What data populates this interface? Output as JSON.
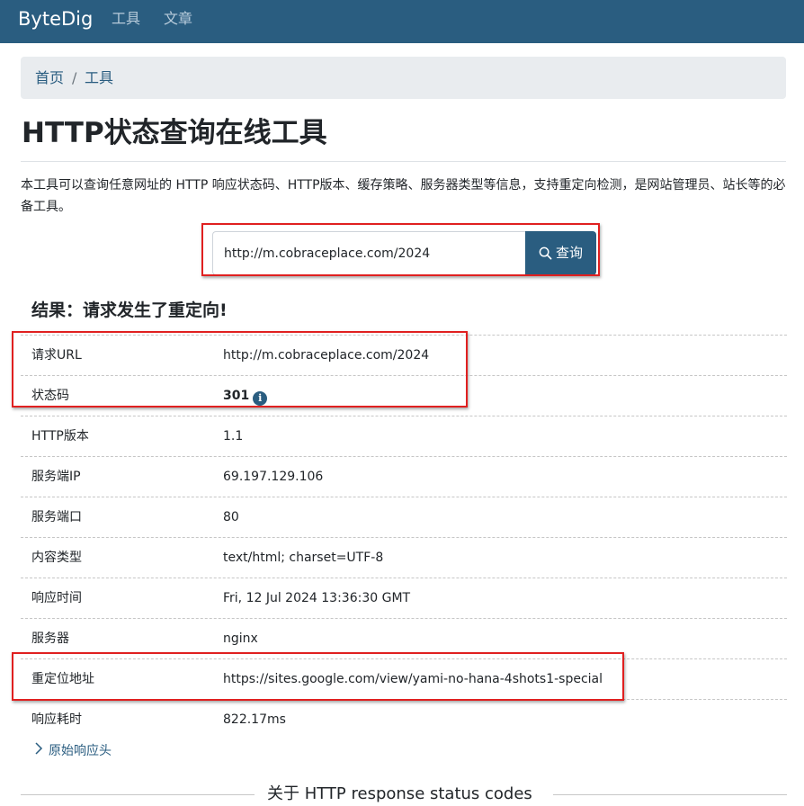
{
  "navbar": {
    "brand": "ByteDig",
    "links": [
      "工具",
      "文章"
    ]
  },
  "breadcrumb": {
    "home": "首页",
    "separator": "/",
    "current": "工具"
  },
  "page": {
    "title": "HTTP状态查询在线工具",
    "intro": "本工具可以查询任意网址的 HTTP 响应状态码、HTTP版本、缓存策略、服务器类型等信息，支持重定向检测，是网站管理员、站长等的必备工具。"
  },
  "search": {
    "value": "http://m.cobraceplace.com/2024",
    "button_label": "查询"
  },
  "result": {
    "title": "结果：请求发生了重定向!",
    "rows": [
      {
        "label": "请求URL",
        "value": "http://m.cobraceplace.com/2024"
      },
      {
        "label": "状态码",
        "value": "301"
      },
      {
        "label": "HTTP版本",
        "value": "1.1"
      },
      {
        "label": "服务端IP",
        "value": "69.197.129.106"
      },
      {
        "label": "服务端口",
        "value": "80"
      },
      {
        "label": "内容类型",
        "value": "text/html; charset=UTF-8"
      },
      {
        "label": "响应时间",
        "value": "Fri, 12 Jul 2024 13:36:30 GMT"
      },
      {
        "label": "服务器",
        "value": "nginx"
      },
      {
        "label": "重定位地址",
        "value": "https://sites.google.com/view/yami-no-hana-4shots1-special"
      },
      {
        "label": "响应耗时",
        "value": "822.17ms"
      }
    ],
    "raw_headers_label": "原始响应头"
  },
  "section": {
    "heading": "关于 HTTP response status codes"
  },
  "colors": {
    "navbar": "#2a5d80",
    "accent": "#2a5d80",
    "highlight_box": "#e02020"
  }
}
